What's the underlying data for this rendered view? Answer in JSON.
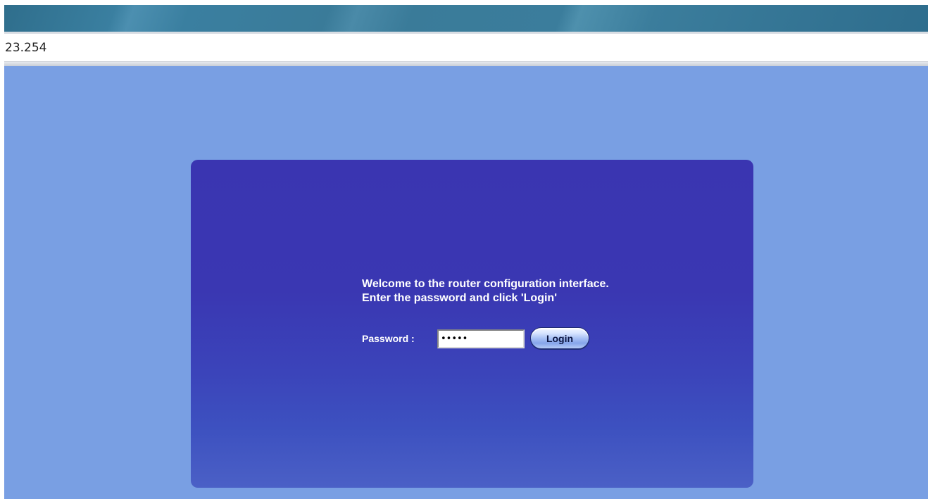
{
  "browser": {
    "address": "23.254"
  },
  "login": {
    "welcome_line1": "Welcome to the router configuration interface.",
    "welcome_line2": "Enter the password and click 'Login'",
    "password_label": "Password :",
    "password_value": "•••••",
    "login_button": "Login"
  },
  "colors": {
    "page_background": "#799fe3",
    "panel_background": "#3a35b1"
  }
}
